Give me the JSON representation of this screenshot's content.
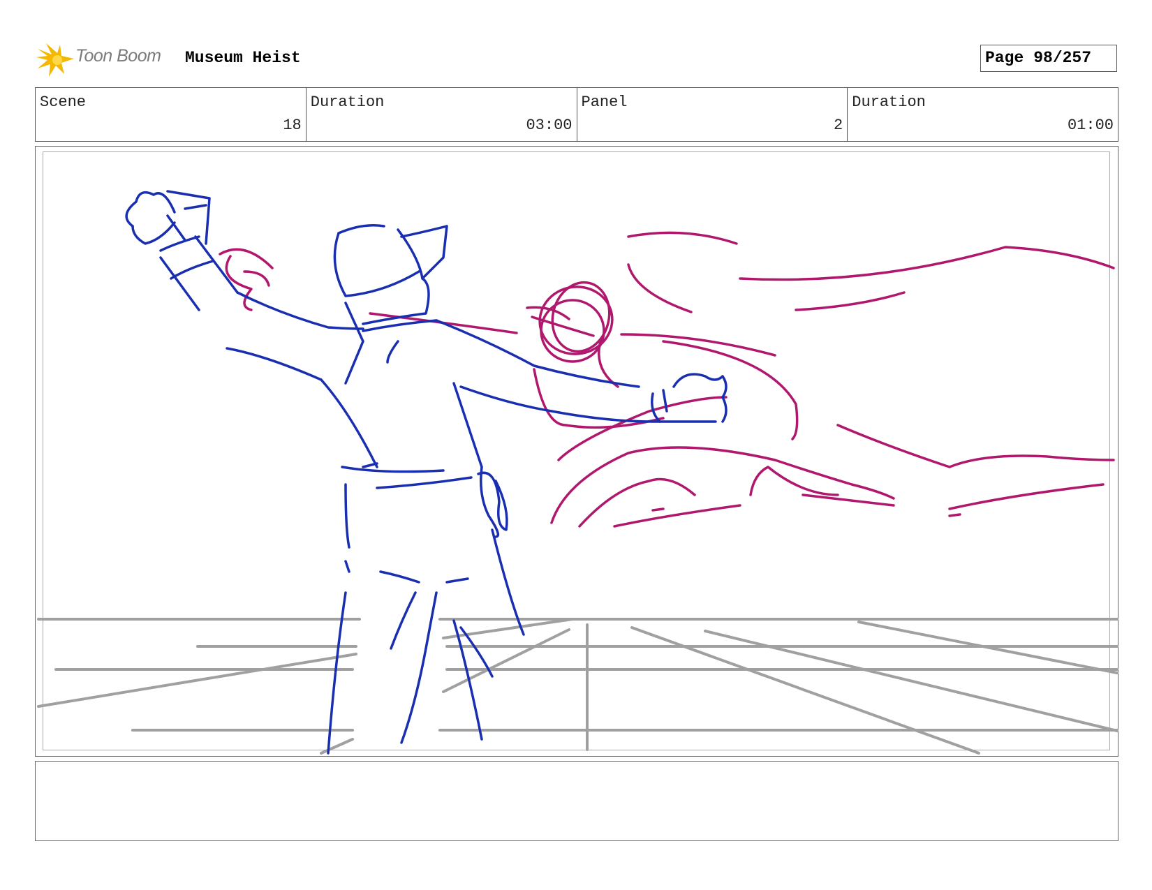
{
  "header": {
    "logo_text": "Toon Boom",
    "project_title": "Museum Heist",
    "page_label": "Page",
    "page_number": "98/257"
  },
  "info": {
    "scene_label": "Scene",
    "scene_value": "18",
    "scene_duration_label": "Duration",
    "scene_duration_value": "03:00",
    "panel_label": "Panel",
    "panel_value": "2",
    "panel_duration_label": "Duration",
    "panel_duration_value": "01:00"
  },
  "colors": {
    "logo_star": "#f5b800",
    "figure_blue": "#1a2fb0",
    "figure_magenta": "#b0186e",
    "floor_gray": "#a0a0a0"
  },
  "notes": {
    "text": ""
  }
}
